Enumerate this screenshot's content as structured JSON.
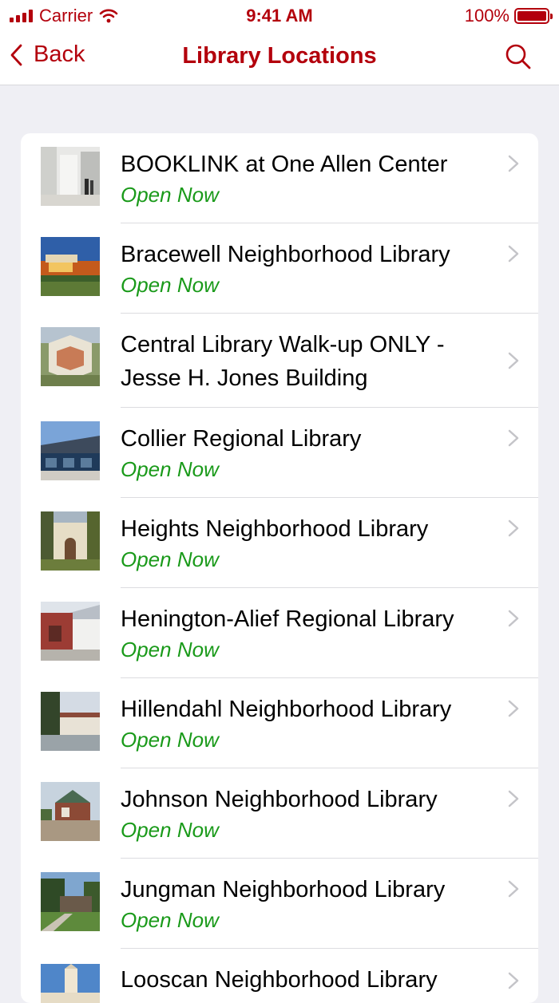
{
  "status_bar": {
    "carrier": "Carrier",
    "time": "9:41 AM",
    "battery": "100%",
    "battery_level": 1.0,
    "signal_bars": 3
  },
  "nav": {
    "back_label": "Back",
    "title": "Library Locations",
    "accent_color": "#b3000c"
  },
  "locations": [
    {
      "name": "BOOKLINK at One Allen Center",
      "status": "Open Now"
    },
    {
      "name": "Bracewell Neighborhood Library",
      "status": "Open Now"
    },
    {
      "name": "Central Library Walk-up ONLY - Jesse H. Jones Building",
      "status": ""
    },
    {
      "name": "Collier Regional Library",
      "status": "Open Now"
    },
    {
      "name": "Heights Neighborhood Library",
      "status": "Open Now"
    },
    {
      "name": "Henington-Alief Regional Library",
      "status": "Open Now"
    },
    {
      "name": "Hillendahl Neighborhood Library",
      "status": "Open Now"
    },
    {
      "name": "Johnson Neighborhood Library",
      "status": "Open Now"
    },
    {
      "name": "Jungman Neighborhood Library",
      "status": "Open Now"
    },
    {
      "name": "Looscan Neighborhood Library",
      "status": ""
    }
  ],
  "colors": {
    "open_status": "#1a9a1a",
    "background": "#efeff4"
  }
}
